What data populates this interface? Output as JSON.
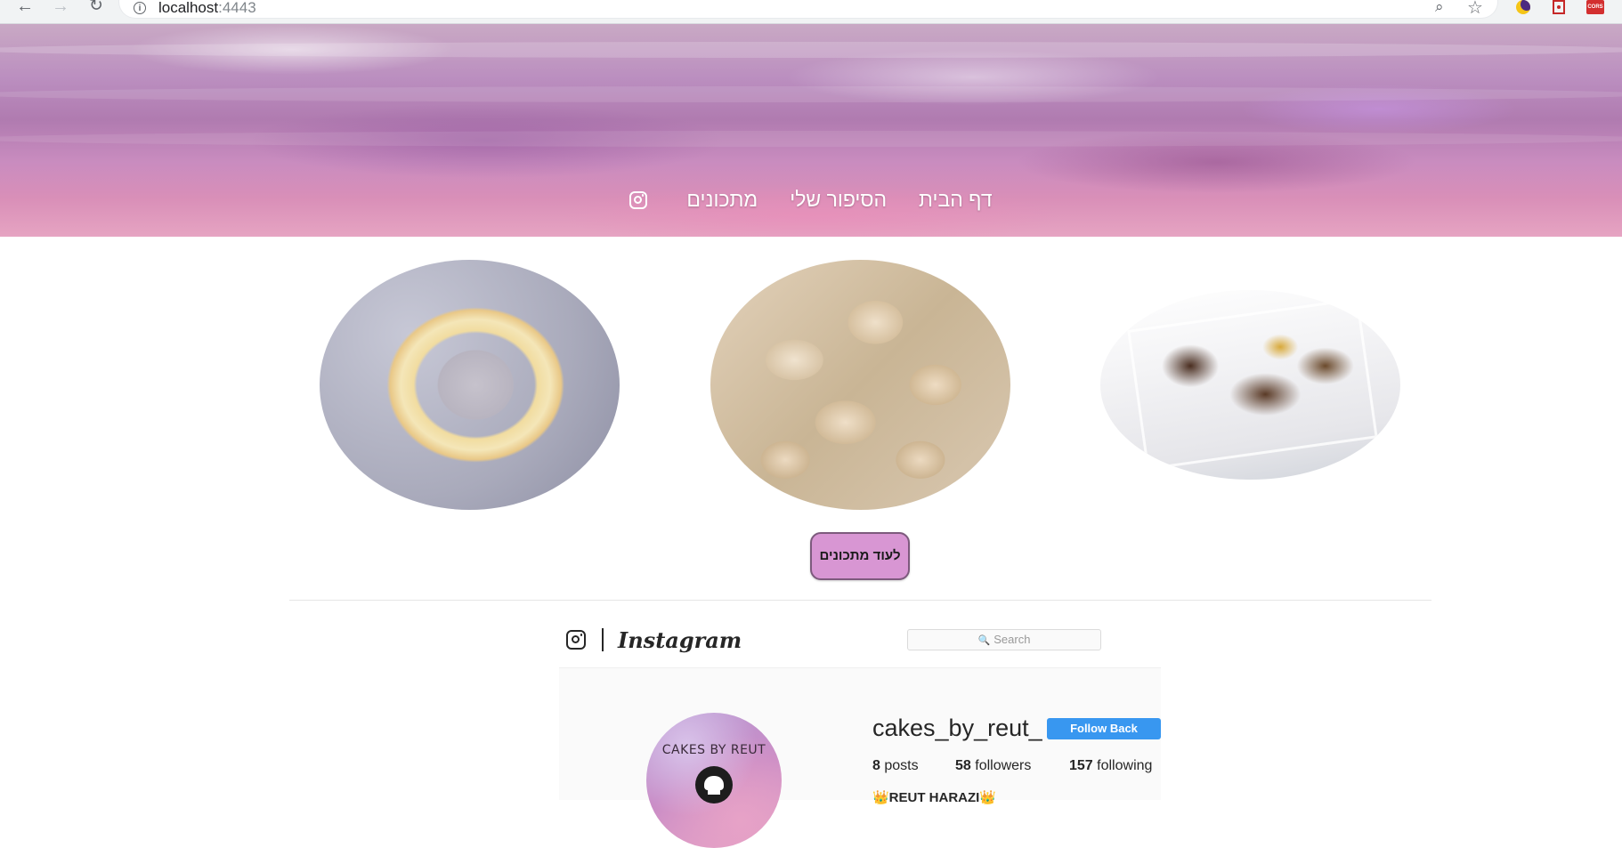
{
  "browser": {
    "url_host": "localhost",
    "url_port": ":4443",
    "nav_icons": [
      "back-arrow-icon",
      "forward-arrow-icon",
      "reload-icon"
    ]
  },
  "hero": {
    "nav_links": [
      "דף הבית",
      "הסיפור שלי",
      "מתכונים"
    ],
    "social_icon": "instagram-icon"
  },
  "gallery": {
    "photos": [
      "fruit-cream-cake-photo",
      "cookies-photo",
      "chocolate-letter-cake-photo"
    ]
  },
  "more_recipes_button": "לעוד מתכונים",
  "instagram": {
    "wordmark": "Instagram",
    "search_placeholder": "Search",
    "avatar_text": "CAKES BY REUT",
    "username": "cakes_by_reut_",
    "follow_button": "Follow Back",
    "stats": {
      "posts_count": "8",
      "posts_label": "posts",
      "followers_count": "58",
      "followers_label": "followers",
      "following_count": "157",
      "following_label": "following"
    },
    "full_name": "👑REUT HARAZI👑",
    "colors": {
      "follow_button": "#3897f0",
      "more_button": "#d896d3"
    }
  }
}
